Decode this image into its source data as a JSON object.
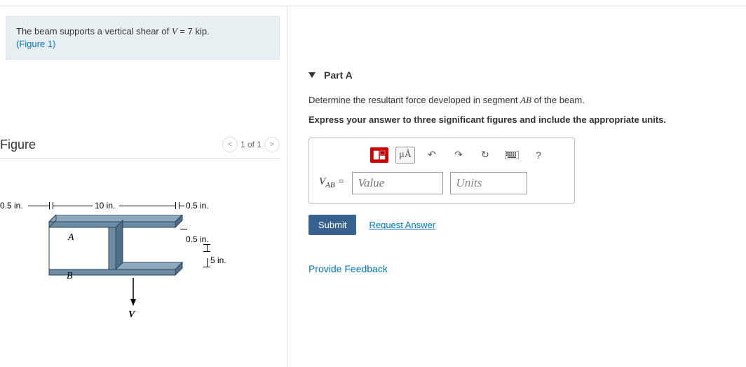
{
  "problem": {
    "text_prefix": "The beam supports a vertical shear of ",
    "variable": "V",
    "equals": " = 7 kip.",
    "figure_ref": "(Figure 1)"
  },
  "figure": {
    "title": "Figure",
    "pager_text": "1 of 1",
    "labels": {
      "dim_05_left": "0.5 in.",
      "dim_10": "10 in.",
      "dim_05_right": "0.5 in.",
      "dim_05_top": "0.5 in.",
      "dim_5": "5 in.",
      "point_a": "A",
      "point_b": "B",
      "force_v": "V"
    }
  },
  "part": {
    "title": "Part A",
    "question_prefix": "Determine the resultant force developed in segment ",
    "segment": "AB",
    "question_suffix": " of the beam.",
    "instruction": "Express your answer to three significant figures and include the appropriate units.",
    "toolbar": {
      "mu_label": "μÅ",
      "help": "?"
    },
    "answer": {
      "var": "V",
      "sub": "AB",
      "equals": " = ",
      "value_placeholder": "Value",
      "units_placeholder": "Units"
    },
    "submit_label": "Submit",
    "request_label": "Request Answer"
  },
  "feedback_label": "Provide Feedback"
}
